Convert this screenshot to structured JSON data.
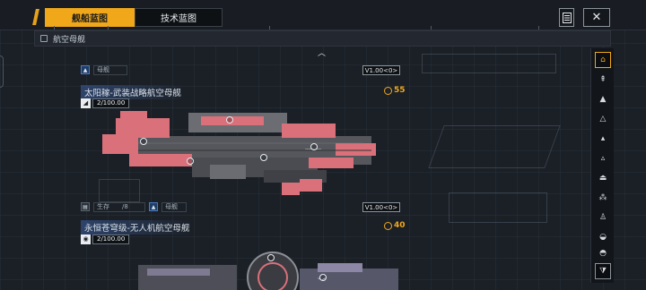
{
  "tabs": [
    {
      "label": "舰船蓝图",
      "active": true
    },
    {
      "label": "技术蓝图",
      "active": false
    }
  ],
  "category": {
    "label": "航空母舰"
  },
  "entries": [
    {
      "partial_label": "母舰",
      "version": "V1.00<0>"
    },
    {
      "name": "太阳稼-武装战略航空母舰",
      "cost": "55",
      "count": "2/100.00",
      "status_left": "生存",
      "status_mid": "/8",
      "type_label": "母舰",
      "version": "V1.00<0>"
    },
    {
      "name": "永恒苍穹级-无人机航空母舰",
      "cost": "40",
      "count": "2/100.00"
    }
  ],
  "ship_text": "----------",
  "colors": {
    "accent": "#f0a81a",
    "hull_red": "#d9707a",
    "hull_grey": "#55575c"
  },
  "icons": {
    "doc": "document-icon",
    "close": "close-icon",
    "filter": "filter-icon",
    "up": "chevron-up-icon",
    "down": "chevron-down-icon"
  }
}
